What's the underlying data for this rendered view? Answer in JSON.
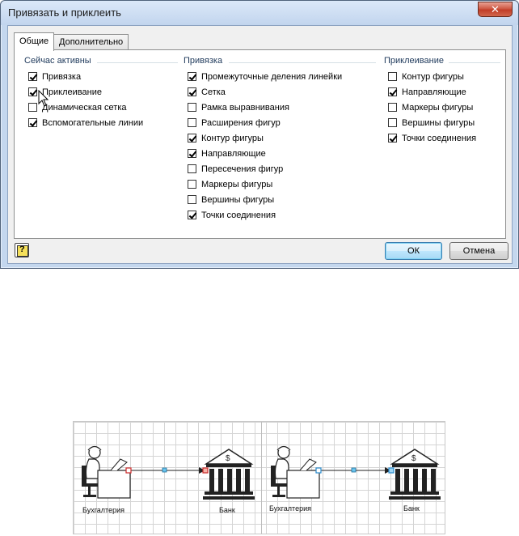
{
  "dialog": {
    "title": "Привязать и приклеить",
    "close_label": "✕",
    "tabs": [
      "Общие",
      "Дополнительно"
    ],
    "groups": {
      "active": {
        "title": "Сейчас активны",
        "items": [
          {
            "label": "Привязка",
            "checked": true
          },
          {
            "label": "Приклеивание",
            "checked": true
          },
          {
            "label": "Динамическая сетка",
            "checked": false
          },
          {
            "label": "Вспомогательные линии",
            "checked": true
          }
        ]
      },
      "snap": {
        "title": "Привязка",
        "items": [
          {
            "label": "Промежуточные деления линейки",
            "checked": true
          },
          {
            "label": "Сетка",
            "checked": true
          },
          {
            "label": "Рамка выравнивания",
            "checked": false
          },
          {
            "label": "Расширения фигур",
            "checked": false
          },
          {
            "label": "Контур фигуры",
            "checked": true
          },
          {
            "label": "Направляющие",
            "checked": true
          },
          {
            "label": "Пересечения фигур",
            "checked": false
          },
          {
            "label": "Маркеры фигуры",
            "checked": false
          },
          {
            "label": "Вершины фигуры",
            "checked": false
          },
          {
            "label": "Точки соединения",
            "checked": true
          }
        ]
      },
      "glue": {
        "title": "Приклеивание",
        "items": [
          {
            "label": "Контур фигуры",
            "checked": false
          },
          {
            "label": "Направляющие",
            "checked": true
          },
          {
            "label": "Маркеры фигуры",
            "checked": false
          },
          {
            "label": "Вершины фигуры",
            "checked": false
          },
          {
            "label": "Точки соединения",
            "checked": true
          }
        ]
      }
    },
    "help_label": "?",
    "ok_label": "ОК",
    "cancel_label": "Отмена"
  },
  "diagram": {
    "left": {
      "accountant_label": "Бухгалтерия",
      "bank_label": "Банк",
      "connection_color": "#cc2a2a"
    },
    "right": {
      "accountant_label": "Бухгалтерия",
      "bank_label": "Банк",
      "connection_color": "#2a8acc"
    }
  }
}
